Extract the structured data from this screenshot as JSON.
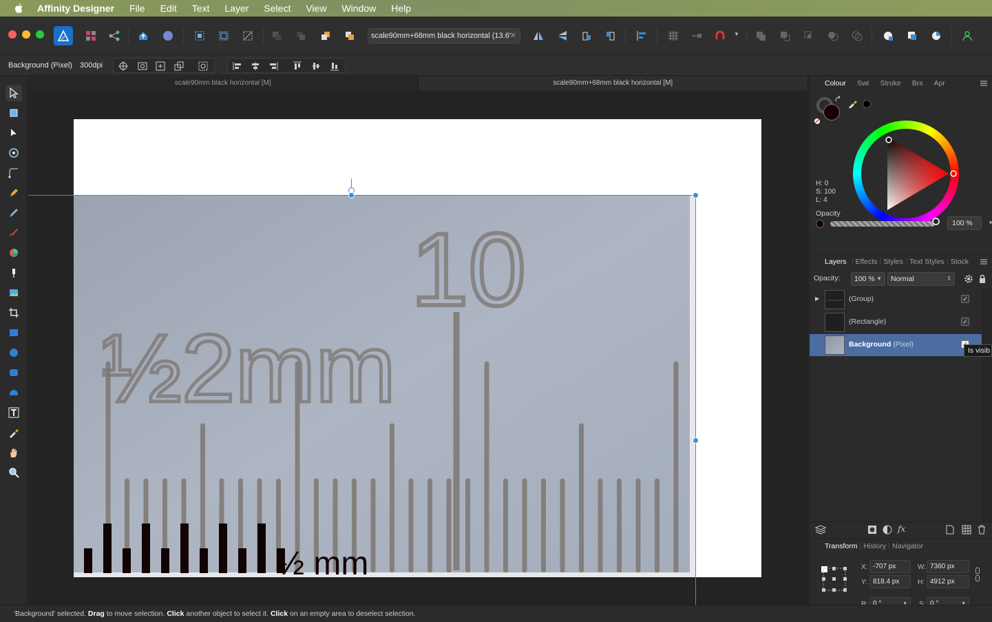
{
  "menubar": {
    "app_name": "Affinity Designer",
    "items": [
      "File",
      "Edit",
      "Text",
      "Layer",
      "Select",
      "View",
      "Window",
      "Help"
    ]
  },
  "toolbar": {
    "document_select": "scale90mm+68mm black horizontal (13.6'"
  },
  "context_toolbar": {
    "selection_label": "Background (Pixel)",
    "dpi": "300dpi"
  },
  "document_tabs": [
    {
      "label": "scale90mm black horizontal [M]",
      "active": false
    },
    {
      "label": "scale90mm+68mm black horizontal [M]",
      "active": true
    }
  ],
  "canvas": {
    "overlay_label": "½ mm",
    "photo_labels": [
      "½2mm",
      "10"
    ]
  },
  "colour_panel": {
    "tabs": [
      "Colour",
      "Swt",
      "Stroke",
      "Brs",
      "Apr"
    ],
    "h": "H: 0",
    "s": "S: 100",
    "l": "L: 4",
    "opacity_label": "Opacity",
    "opacity_value": "100 %",
    "fill_color": "#1a0000",
    "accent": "#3d8de0"
  },
  "layers_panel": {
    "tabs": [
      "Layers",
      "Effects",
      "Styles",
      "Text Styles",
      "Stock"
    ],
    "opacity_label": "Opacity:",
    "opacity_value": "100 %",
    "blend_mode": "Normal",
    "rows": [
      {
        "name": "(Group)",
        "type": "",
        "visible": true,
        "selected": false
      },
      {
        "name": "(Rectangle)",
        "type": "",
        "visible": true,
        "selected": false
      },
      {
        "name": "Background",
        "type": "(Pixel)",
        "visible": true,
        "selected": true
      }
    ],
    "tooltip": "Is visib"
  },
  "transform_panel": {
    "tabs": [
      "Transform",
      "History",
      "Navigator"
    ],
    "x_label": "X:",
    "x": "-707 px",
    "y_label": "Y:",
    "y": "818.4 px",
    "w_label": "W:",
    "w": "7360 px",
    "h_label": "H:",
    "h": "4912 px",
    "r_label": "R:",
    "r": "0 °",
    "s_label": "S:",
    "s": "0 °"
  },
  "status": {
    "p1": "'Background' selected. ",
    "b1": "Drag",
    "p2": " to move selection. ",
    "b2": "Click",
    "p3": " another object to select it. ",
    "b3": "Click",
    "p4": " on an empty area to deselect selection."
  }
}
